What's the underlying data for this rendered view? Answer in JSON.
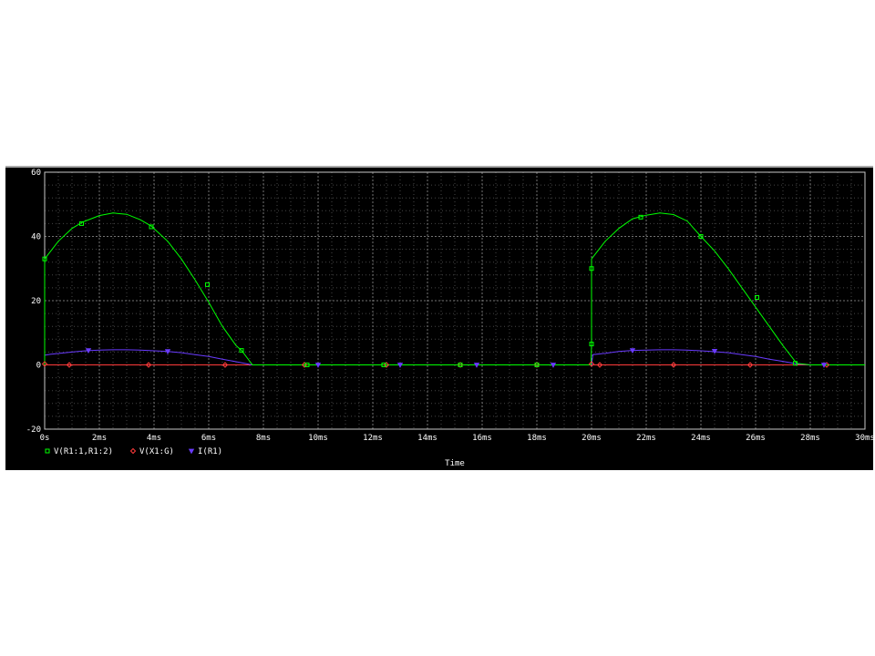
{
  "chart_data": {
    "type": "line",
    "xlabel": "Time",
    "xlim": [
      0,
      30
    ],
    "ylim": [
      -20,
      60
    ],
    "x_ticks": [
      0,
      2,
      4,
      6,
      8,
      10,
      12,
      14,
      16,
      18,
      20,
      22,
      24,
      26,
      28,
      30
    ],
    "x_tick_labels": [
      "0s",
      "2ms",
      "4ms",
      "6ms",
      "8ms",
      "10ms",
      "12ms",
      "14ms",
      "16ms",
      "18ms",
      "20ms",
      "22ms",
      "24ms",
      "26ms",
      "28ms",
      "30ms"
    ],
    "y_ticks": [
      -20,
      0,
      20,
      40,
      60
    ],
    "y_tick_labels": [
      "-20",
      "0",
      "20",
      "40",
      "60"
    ],
    "grid": true,
    "legend_position": "bottom-left",
    "background": "#000000",
    "grid_color": "#808080",
    "series": [
      {
        "name": "V(R1:1,R1:2)",
        "color": "#00ff00",
        "marker": "square",
        "x": [
          0,
          0,
          0.5,
          1,
          1.4,
          2,
          2.5,
          3,
          3.5,
          3.9,
          4.5,
          5,
          5.5,
          6,
          6.5,
          7,
          7.2,
          7.6,
          8,
          10,
          12,
          14,
          16,
          18,
          19.98,
          20,
          20,
          20.5,
          21,
          21.5,
          22,
          22.5,
          23,
          23.5,
          24,
          24.5,
          25,
          25.5,
          26,
          26.5,
          27,
          27.5,
          28,
          30
        ],
        "y": [
          0,
          33,
          38.5,
          42.5,
          44.5,
          46.5,
          47.3,
          46.9,
          45.2,
          43.2,
          38.5,
          33,
          26.5,
          19.5,
          12,
          6,
          4.5,
          0,
          0,
          0,
          0,
          0,
          0,
          0,
          0,
          6.5,
          33,
          38.5,
          42.5,
          45.5,
          46.6,
          47.3,
          46.8,
          44.8,
          40,
          35.5,
          30,
          24,
          18,
          12,
          6,
          0.5,
          0,
          0
        ],
        "marker_x": [
          0,
          1.35,
          3.9,
          5.95,
          7.2,
          9.6,
          12.4,
          15.2,
          18,
          20,
          20,
          21.8,
          24,
          26.05,
          27.45
        ],
        "marker_y": [
          33,
          44,
          43,
          25,
          4.5,
          0,
          0,
          0,
          0,
          6.5,
          30,
          46,
          40,
          21,
          0.5
        ]
      },
      {
        "name": "V(X1:G)",
        "color": "#ff3b3b",
        "marker": "diamond",
        "x": [
          0,
          30
        ],
        "y": [
          0,
          0
        ],
        "marker_x": [
          0,
          0.9,
          3.8,
          6.6,
          9.5,
          12.5,
          15.2,
          18,
          20,
          20.3,
          23,
          25.8,
          28.6
        ],
        "marker_y": [
          0.3,
          0,
          0,
          0,
          0,
          0,
          0,
          0,
          0.3,
          0,
          0,
          0,
          0
        ]
      },
      {
        "name": "I(R1)",
        "color": "#6a3bff",
        "marker": "triangle",
        "x": [
          0,
          0.2,
          1,
          1.5,
          2,
          2.5,
          3,
          3.5,
          4,
          4.5,
          5,
          5.5,
          6,
          6.5,
          7,
          7.6,
          8,
          20,
          20.05,
          20.5,
          21,
          21.5,
          22,
          22.5,
          23,
          23.5,
          24,
          24.5,
          25,
          25.5,
          26,
          26.5,
          27,
          27.5,
          28,
          30
        ],
        "y": [
          3,
          3.3,
          4,
          4.4,
          4.6,
          4.7,
          4.7,
          4.6,
          4.4,
          4.2,
          3.8,
          3.2,
          2.6,
          1.8,
          1,
          0,
          0,
          0,
          3.2,
          3.6,
          4.2,
          4.5,
          4.6,
          4.7,
          4.7,
          4.6,
          4.4,
          4.1,
          3.8,
          3.2,
          2.6,
          1.8,
          1.1,
          0.3,
          0,
          0
        ],
        "marker_x": [
          1.6,
          4.5,
          10,
          13,
          15.8,
          18.6,
          21.5,
          24.5,
          28.5
        ],
        "marker_y": [
          4.5,
          4.2,
          0,
          0,
          0,
          0,
          4.5,
          4.3,
          0
        ]
      }
    ]
  }
}
